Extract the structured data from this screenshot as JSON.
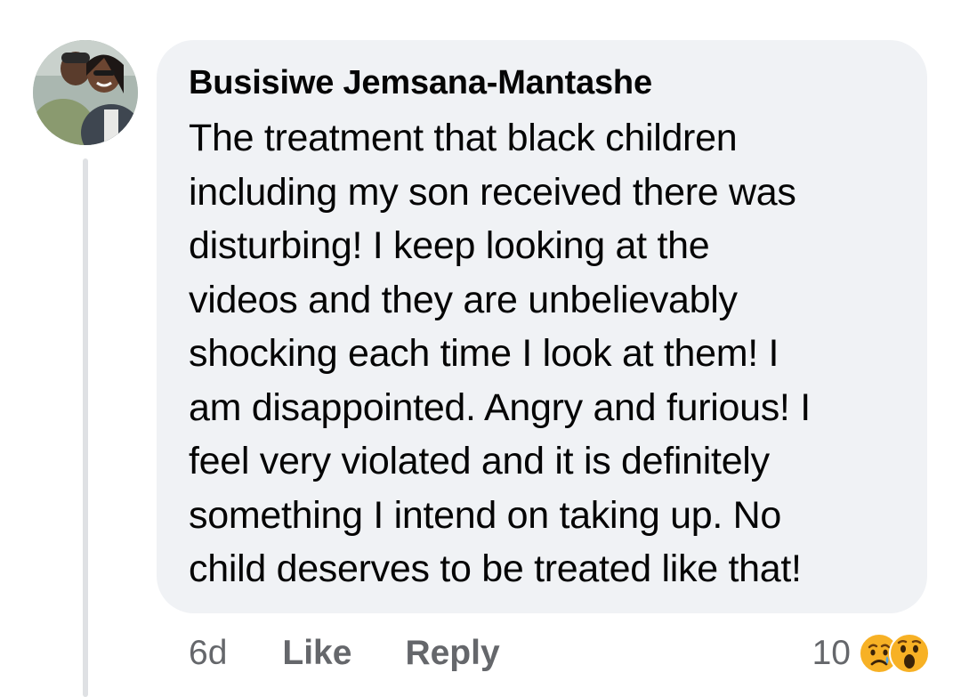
{
  "comment": {
    "author": "Busisiwe Jemsana-Mantashe",
    "lines": [
      "The treatment that black children",
      "including my son received there was",
      "disturbing! I keep looking at the",
      "videos and they are unbelievably",
      "shocking each time I look at them! I",
      "am disappointed. Angry and furious! I",
      "feel very violated and it is definitely",
      "something I intend on taking up. No",
      "child deserves to be treated like that!"
    ]
  },
  "actions": {
    "time": "6d",
    "like_label": "Like",
    "reply_label": "Reply"
  },
  "reactions": {
    "count": "10",
    "icons": [
      "sad-reaction-icon",
      "wow-reaction-icon"
    ]
  },
  "colors": {
    "bubble_bg": "#f0f2f5",
    "text_primary": "#050505",
    "text_secondary": "#65676b",
    "thread_line": "#dfe1e4",
    "reaction_yellow": "#f7b125"
  }
}
